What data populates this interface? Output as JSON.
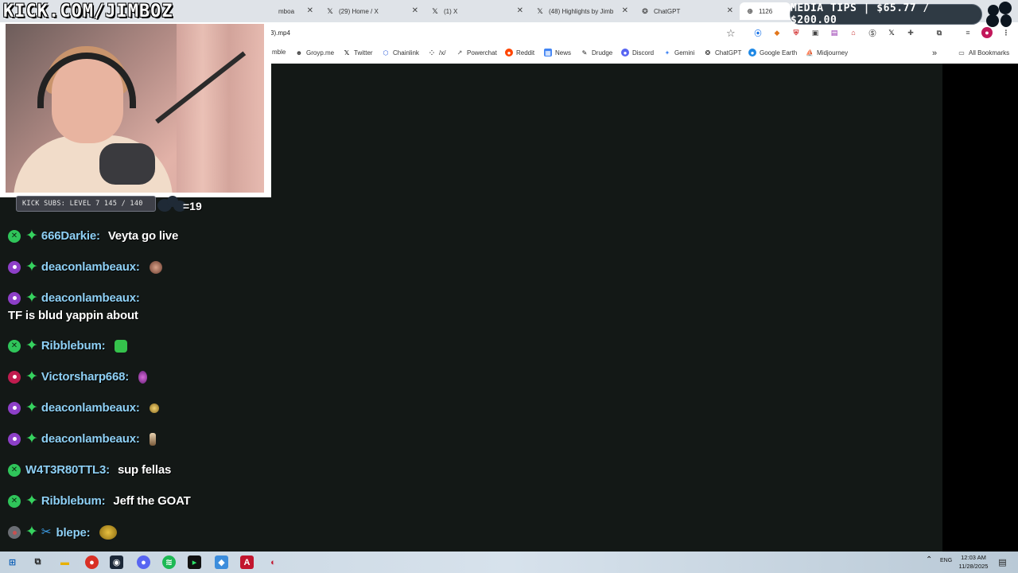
{
  "overlay": {
    "brand": "KICK.COM/JIMBOZ",
    "subs_label": "KICK SUBS: LEVEL 7 145 / 140",
    "subs_count": "=19",
    "media_tips": "MEDIA TIPS | $65.77 / $200.00"
  },
  "browser": {
    "tabs": [
      {
        "label": "mboa",
        "icon": "globe-icon"
      },
      {
        "label": "(29) Home / X",
        "icon": "x-logo-icon"
      },
      {
        "label": "(1) X",
        "icon": "x-logo-icon"
      },
      {
        "label": "(48) Highlights by Jimb",
        "icon": "x-logo-icon"
      },
      {
        "label": "ChatGPT",
        "icon": "chatgpt-icon"
      },
      {
        "label": "1126",
        "icon": "globe-icon"
      }
    ],
    "url": "3).mp4",
    "bookmarks": [
      {
        "label": "mble",
        "icon": ""
      },
      {
        "label": "Groyp.me",
        "icon": "groyp-icon"
      },
      {
        "label": "Twitter",
        "icon": "x-logo-icon"
      },
      {
        "label": "Chainlink",
        "icon": "chainlink-icon"
      },
      {
        "label": "/x/",
        "icon": "apps-icon"
      },
      {
        "label": "Powerchat",
        "icon": "powerchat-icon"
      },
      {
        "label": "Reddit",
        "icon": "reddit-icon"
      },
      {
        "label": "News",
        "icon": "news-icon"
      },
      {
        "label": "Drudge",
        "icon": "drudge-icon"
      },
      {
        "label": "Discord",
        "icon": "discord-icon"
      },
      {
        "label": "Gemini",
        "icon": "gemini-icon"
      },
      {
        "label": "ChatGPT",
        "icon": "chatgpt-icon"
      },
      {
        "label": "Google Earth",
        "icon": "google-earth-icon"
      },
      {
        "label": "Midjourney",
        "icon": "midjourney-icon"
      }
    ],
    "all_bookmarks": "All Bookmarks",
    "more_bookmarks": "»"
  },
  "chat": {
    "messages": [
      {
        "user": "666Darkie:",
        "text": "Veyta go live",
        "badge": "green"
      },
      {
        "user": "deaconlambeaux:",
        "text": "",
        "badge": "purple"
      },
      {
        "user": "deaconlambeaux:",
        "text": "TF is blud yappin about",
        "badge": "purple"
      },
      {
        "user": "Ribblebum:",
        "text": "",
        "badge": "green"
      },
      {
        "user": "Victorsharp668:",
        "text": "",
        "badge": "red"
      },
      {
        "user": "deaconlambeaux:",
        "text": "",
        "badge": "purple"
      },
      {
        "user": "deaconlambeaux:",
        "text": "",
        "badge": "purple"
      },
      {
        "user": "W4T3R80TTL3:",
        "text": "sup fellas",
        "badge": "green"
      },
      {
        "user": "Ribblebum:",
        "text": "Jeff the GOAT",
        "badge": "green"
      },
      {
        "user": "blepe:",
        "text": "",
        "badge": "gray"
      }
    ]
  },
  "taskbar": {
    "lang": "ENG",
    "time": "12:03 AM",
    "date": "11/28/2025"
  }
}
